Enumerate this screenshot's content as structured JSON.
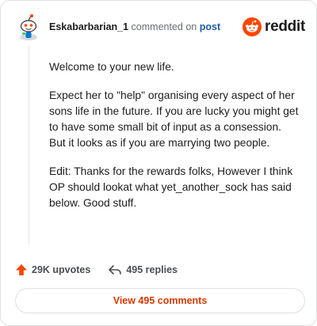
{
  "comment": {
    "username": "Eskabarbarian_1",
    "action_text": "commented on",
    "post_link": "post",
    "paragraphs": [
      "Welcome to your new life.",
      "Expect her to \"help\" organising every aspect of her sons life in the future. If you are lucky you might get to have some small bit of input as a consession. But it looks as if you are marrying two people.",
      "Edit: Thanks for the rewards folks, However I think OP should lookat what yet_another_sock has said below. Good stuff."
    ]
  },
  "brand": {
    "name": "reddit",
    "color": "#ff4500",
    "icon": "reddit-logo-icon"
  },
  "stats": {
    "upvotes": "29K upvotes",
    "replies": "495 replies",
    "upvote_icon": "upvote-arrow-icon",
    "reply_icon": "reply-arrow-icon"
  },
  "view_button": {
    "label": "View 495 comments",
    "color": "#d93a00"
  }
}
